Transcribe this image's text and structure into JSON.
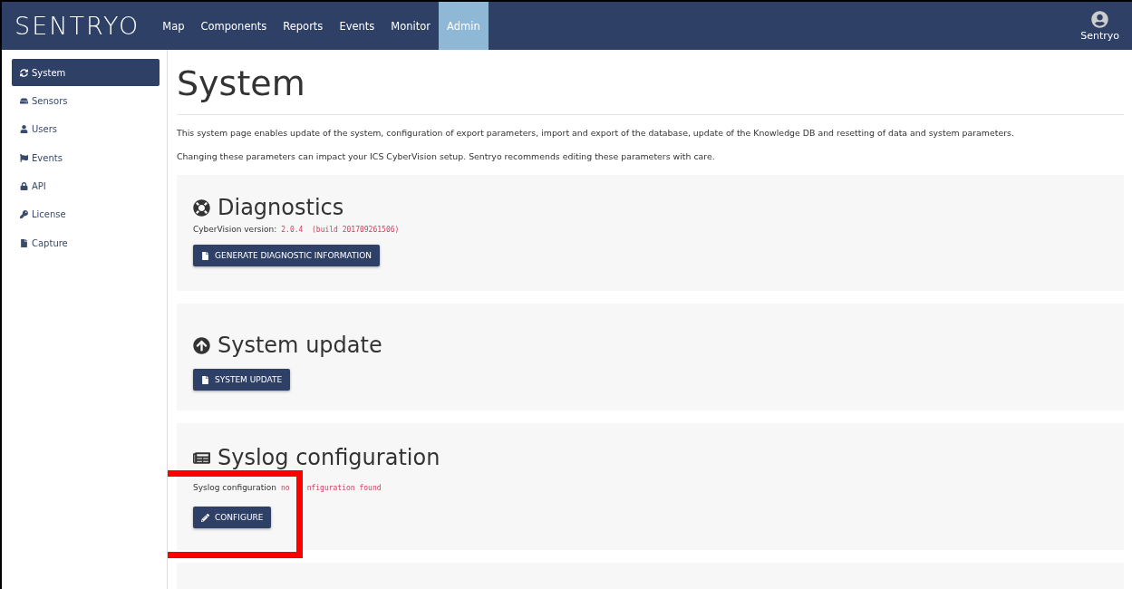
{
  "navbar": {
    "logo": "SENTRYO",
    "items": [
      {
        "label": "Map",
        "selected": false
      },
      {
        "label": "Components",
        "selected": false
      },
      {
        "label": "Reports",
        "selected": false
      },
      {
        "label": "Events",
        "selected": false
      },
      {
        "label": "Monitor",
        "selected": false
      },
      {
        "label": "Admin",
        "selected": true
      }
    ],
    "user": "Sentryo"
  },
  "sidebar": {
    "items": [
      {
        "label": "System",
        "selected": true
      },
      {
        "label": "Sensors",
        "selected": false
      },
      {
        "label": "Users",
        "selected": false
      },
      {
        "label": "Events",
        "selected": false
      },
      {
        "label": "API",
        "selected": false
      },
      {
        "label": "License",
        "selected": false
      },
      {
        "label": "Capture",
        "selected": false
      }
    ]
  },
  "page": {
    "title": "System",
    "paragraphs": [
      "This system page enables update of the system, configuration of export parameters, import and export of the database, update of the Knowledge DB and resetting of data and system parameters.",
      "Changing these parameters can impact your ICS CyberVision setup. Sentryo recommends editing these parameters with care."
    ]
  },
  "sections": [
    {
      "title": "Diagnostics",
      "info_label": "CyberVision version:",
      "info_values": [
        "2.0.4  (build 201709261506)"
      ],
      "button": {
        "label": "GENERATE DIAGNOSTIC INFORMATION"
      }
    },
    {
      "title": "System update",
      "button": {
        "label": "SYSTEM UPDATE"
      }
    },
    {
      "title": "Syslog configuration",
      "info_label": "Syslog configuration",
      "info_values": [
        "no",
        "nfiguration found"
      ],
      "button": {
        "label": "CONFIGURE"
      },
      "highlighted": true
    },
    {
      "kind": "empty"
    }
  ]
}
